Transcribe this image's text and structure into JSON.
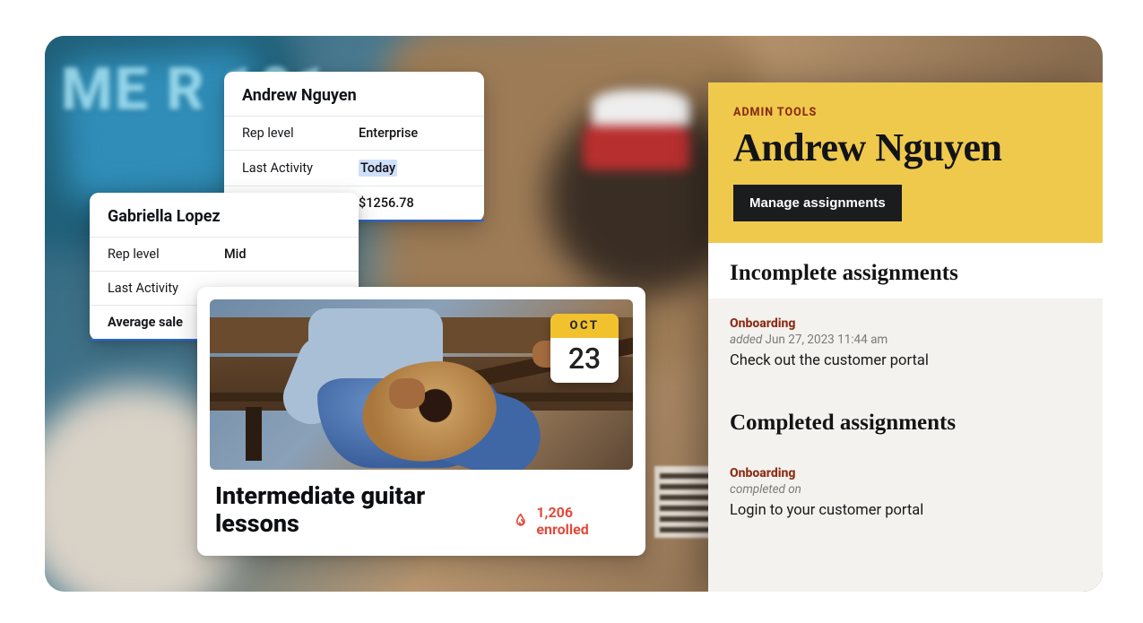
{
  "background": {
    "decorative_text": "ME\nR 101"
  },
  "profile_cards": {
    "andrew": {
      "name": "Andrew Nguyen",
      "rows": [
        {
          "label": "Rep level",
          "value": "Enterprise"
        },
        {
          "label": "Last Activity",
          "value": "Today"
        },
        {
          "label": "",
          "value": "$1256.78"
        }
      ]
    },
    "gabriella": {
      "name": "Gabriella Lopez",
      "rows": [
        {
          "label": "Rep level",
          "value": "Mid"
        },
        {
          "label": "Last Activity",
          "value": ""
        },
        {
          "label": "Average sale",
          "value": ""
        }
      ]
    }
  },
  "lesson_card": {
    "title": "Intermediate guitar lessons",
    "date": {
      "month": "OCT",
      "day": "23"
    },
    "enrolled_count": "1,206 enrolled",
    "icons": {
      "flame": "flame-icon"
    }
  },
  "admin_panel": {
    "eyebrow": "ADMIN TOOLS",
    "name": "Andrew Nguyen",
    "manage_button": "Manage assignments",
    "sections": {
      "incomplete": {
        "title": "Incomplete assignments",
        "items": [
          {
            "tag": "Onboarding",
            "meta_prefix": "added ",
            "meta_date": "Jun 27, 2023 11:44 am",
            "title": "Check out the customer portal"
          }
        ]
      },
      "completed": {
        "title": "Completed assignments",
        "items": [
          {
            "tag": "Onboarding",
            "meta_prefix": "completed on",
            "meta_date": "",
            "title": "Login to your customer portal"
          }
        ]
      }
    }
  }
}
